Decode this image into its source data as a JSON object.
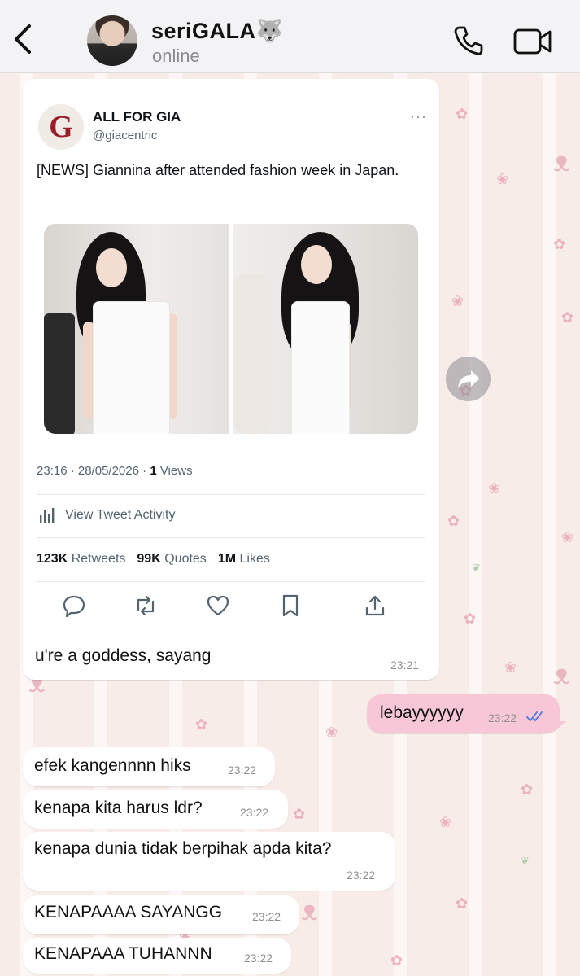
{
  "header": {
    "contact_name": "seriGALA",
    "contact_emoji": "🐺",
    "status": "online"
  },
  "tweet": {
    "account_name": "ALL FOR GIA",
    "handle": "@giacentric",
    "avatar_letter": "G",
    "more": "···",
    "text": "[NEWS] Giannina after attended fashion week in Japan.",
    "time": "23:16",
    "date": "28/05/2026",
    "views_count": "1",
    "views_label": "Views",
    "activity_label": "View Tweet Activity",
    "retweets_count": "123K",
    "retweets_label": "Retweets",
    "quotes_count": "99K",
    "quotes_label": "Quotes",
    "likes_count": "1M",
    "likes_label": "Likes"
  },
  "messages": [
    {
      "dir": "in",
      "text": "u're a goddess, sayang",
      "time": "23:21"
    },
    {
      "dir": "out",
      "text": "lebayyyyyy",
      "time": "23:22",
      "read": true
    },
    {
      "dir": "in",
      "text": "efek kangennnn hiks",
      "time": "23:22"
    },
    {
      "dir": "in",
      "text": "kenapa kita harus ldr?",
      "time": "23:22"
    },
    {
      "dir": "in",
      "text": "kenapa dunia tidak berpihak apda kita?",
      "time": "23:22"
    },
    {
      "dir": "in",
      "text": "KENAPAAAA SAYANGG",
      "time": "23:22"
    },
    {
      "dir": "in",
      "text": "KENAPAAA TUHANNN",
      "time": "23:22"
    }
  ],
  "colors": {
    "outgoing_bubble": "#f8c7d7",
    "read_ticks": "#4f7bd9",
    "brand_logo": "#9a1f2a"
  }
}
